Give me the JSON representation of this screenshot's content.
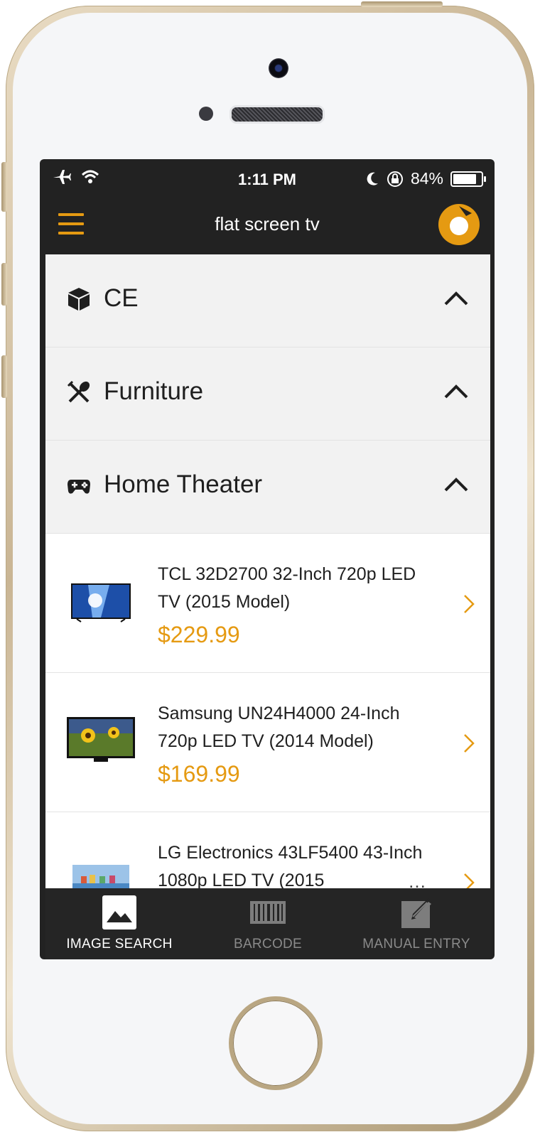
{
  "status_bar": {
    "time": "1:11 PM",
    "battery": "84%",
    "battery_level": 0.84
  },
  "nav": {
    "title": "flat screen tv",
    "menu_icon": "hamburger-icon",
    "logo_icon": "app-logo"
  },
  "categories": [
    {
      "label": "CE",
      "icon": "cube-icon"
    },
    {
      "label": "Furniture",
      "icon": "utensils-icon"
    },
    {
      "label": "Home Theater",
      "icon": "gamepad-icon"
    }
  ],
  "products": [
    {
      "title": "TCL 32D2700 32-Inch 720p LED TV (2015 Model)",
      "price": "$229.99"
    },
    {
      "title": "Samsung UN24H4000 24-Inch 720p LED TV (2014 Model)",
      "price": "$169.99"
    },
    {
      "title": "LG Electronics 43LF5400 43-Inch 1080p LED TV (2015",
      "ellipsis": "…"
    }
  ],
  "tabs": [
    {
      "label": "IMAGE SEARCH",
      "icon": "image-icon",
      "active": true
    },
    {
      "label": "BARCODE",
      "icon": "barcode-icon",
      "active": false
    },
    {
      "label": "MANUAL ENTRY",
      "icon": "edit-icon",
      "active": false
    }
  ],
  "colors": {
    "accent": "#e59a12",
    "bar": "#222222",
    "category_bg": "#f2f2f2",
    "tab_inactive": "#8a8a8a"
  }
}
